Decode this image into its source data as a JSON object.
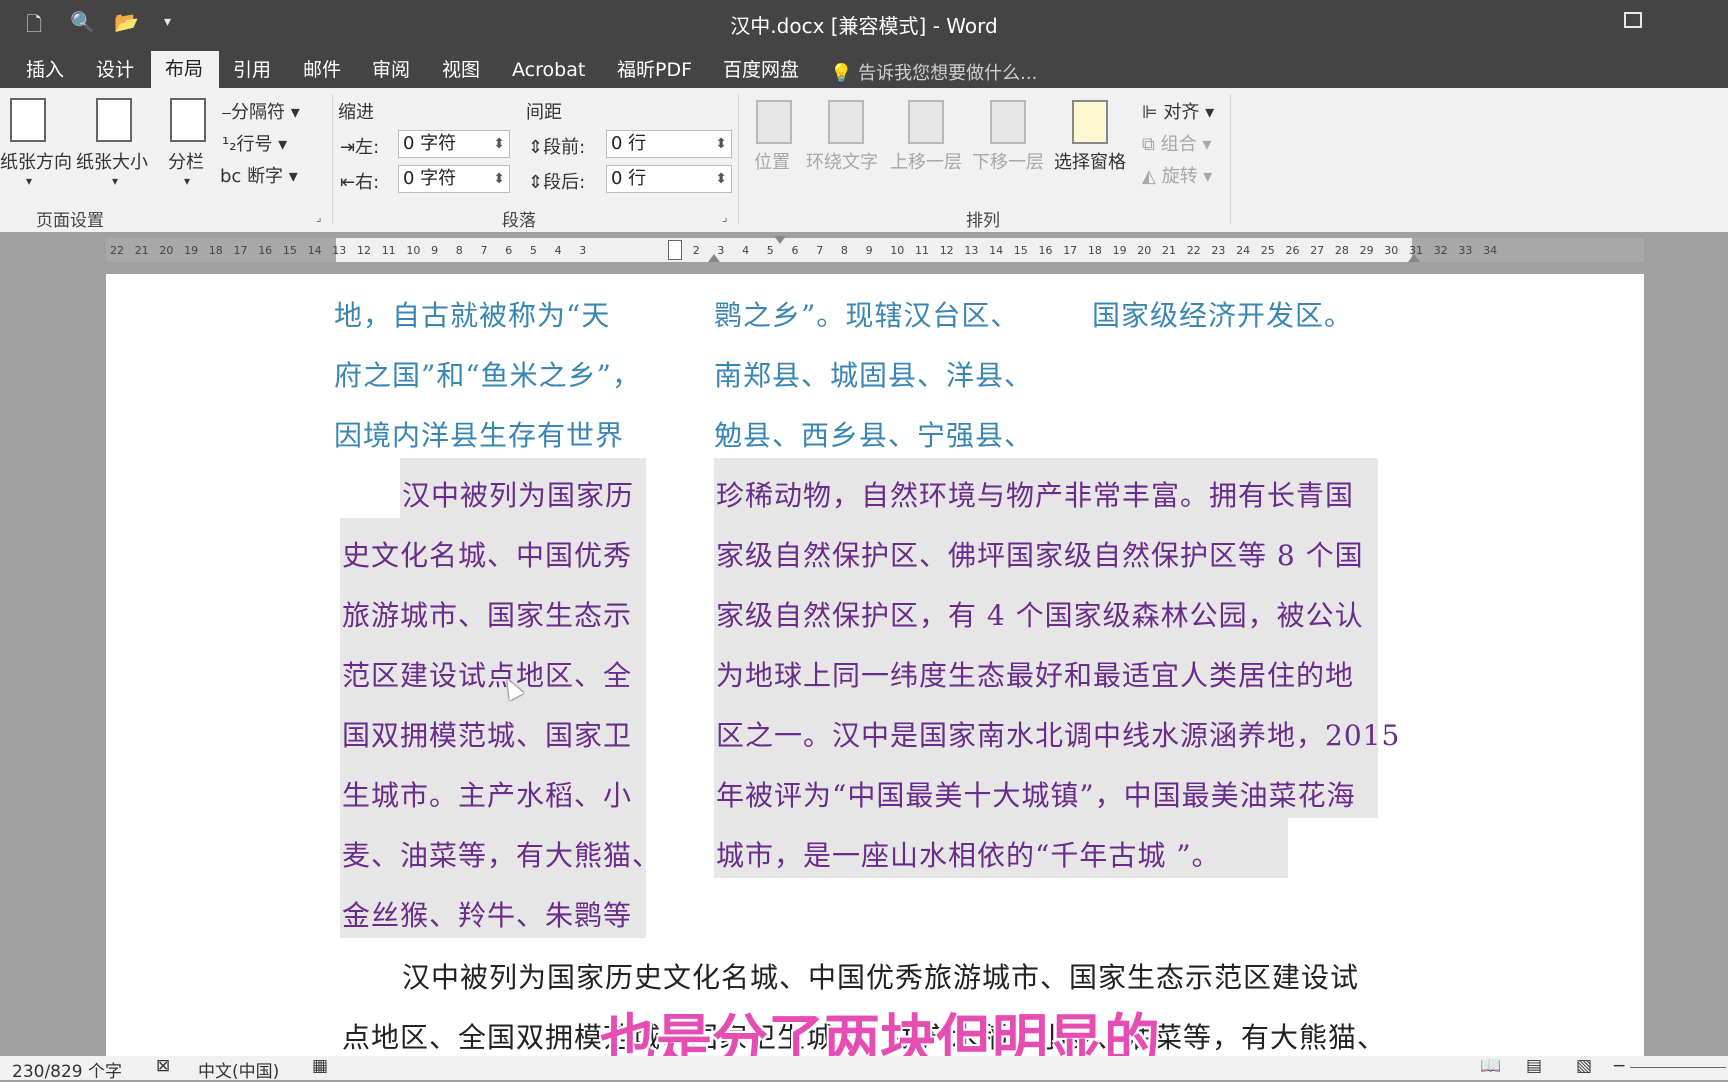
{
  "titlebar": {
    "title": "汉中.docx [兼容模式] - Word",
    "qa_icons": [
      "new-doc-icon",
      "print-preview-icon",
      "open-folder-icon",
      "customize-dropdown-icon"
    ]
  },
  "tabs": [
    {
      "label": "插入",
      "active": false
    },
    {
      "label": "设计",
      "active": false
    },
    {
      "label": "布局",
      "active": true
    },
    {
      "label": "引用",
      "active": false
    },
    {
      "label": "邮件",
      "active": false
    },
    {
      "label": "审阅",
      "active": false
    },
    {
      "label": "视图",
      "active": false
    },
    {
      "label": "Acrobat",
      "active": false
    },
    {
      "label": "福昕PDF",
      "active": false
    },
    {
      "label": "百度网盘",
      "active": false
    }
  ],
  "tellme": "告诉我您想要做什么...",
  "ribbon": {
    "page_setup": {
      "orientation": "纸张方向",
      "size": "纸张大小",
      "columns": "分栏",
      "breaks": "分隔符",
      "line_numbers": "行号",
      "hyphenation": "断字",
      "group_label": "页面设置"
    },
    "paragraph": {
      "indent_title": "缩进",
      "spacing_title": "间距",
      "left_label": "左:",
      "left_value": "0 字符",
      "right_label": "右:",
      "right_value": "0 字符",
      "before_label": "段前:",
      "before_value": "0 行",
      "after_label": "段后:",
      "after_value": "0 行",
      "group_label": "段落"
    },
    "arrange": {
      "position": "位置",
      "wrap_text": "环绕文字",
      "bring_forward": "上移一层",
      "send_backward": "下移一层",
      "selection_pane": "选择窗格",
      "align": "对齐",
      "group": "组合",
      "rotate": "旋转",
      "group_label": "排列"
    }
  },
  "ruler": {
    "left_ticks": [
      "22",
      "21",
      "20",
      "19",
      "18",
      "17",
      "16",
      "15",
      "14",
      "13",
      "12",
      "11",
      "10",
      "9",
      "8",
      "7",
      "6",
      "5",
      "4",
      "3"
    ],
    "right_ticks": [
      "1",
      "2",
      "3",
      "4",
      "5",
      "6",
      "7",
      "8",
      "9",
      "10",
      "11",
      "12",
      "13",
      "14",
      "15",
      "16",
      "17",
      "18",
      "19",
      "20",
      "21",
      "22",
      "23",
      "24",
      "25",
      "26",
      "27",
      "28",
      "29",
      "30",
      "31",
      "32",
      "33",
      "34"
    ]
  },
  "document": {
    "col1_teal": [
      "地，自古就被称为“天",
      "府之国”和“鱼米之乡”，",
      "因境内洋县生存有世界"
    ],
    "col2_teal": [
      "鹮之乡”。现辖汉台区、",
      "南郑县、城固县、洋县、",
      "勉县、西乡县、宁强县、"
    ],
    "col3_teal": [
      "国家级经济开发区。"
    ],
    "col1_purple": [
      "汉中被列为国家历",
      "史文化名城、中国优秀",
      "旅游城市、国家生态示",
      "范区建设试点地区、全",
      "国双拥模范城、国家卫",
      "生城市。主产水稻、小",
      "麦、油菜等，有大熊猫、",
      "金丝猴、羚牛、朱鹮等"
    ],
    "col2_purple": [
      "珍稀动物，自然环境与物产非常丰富。拥有长青国",
      "家级自然保护区、佛坪国家级自然保护区等 8 个国",
      "家级自然保护区，有 4 个国家级森林公园，被公认",
      "为地球上同一纬度生态最好和最适宜人类居住的地",
      "区之一。汉中是国家南水北调中线水源涵养地，2015",
      "年被评为“中国最美十大城镇”，中国最美油菜花海",
      "城市，是一座山水相依的“千年古城 ”。"
    ],
    "body_black": [
      "汉中被列为国家历史文化名城、中国优秀旅游城市、国家生态示范区建设试",
      "点地区、全国双拥模范城、国家卫生城市。主产水稻、小麦、油菜等，有大熊猫、"
    ]
  },
  "status": {
    "word_count": "230/829 个字",
    "language": "中文(中国)"
  },
  "subtitle": "也是分了两块但明显的"
}
